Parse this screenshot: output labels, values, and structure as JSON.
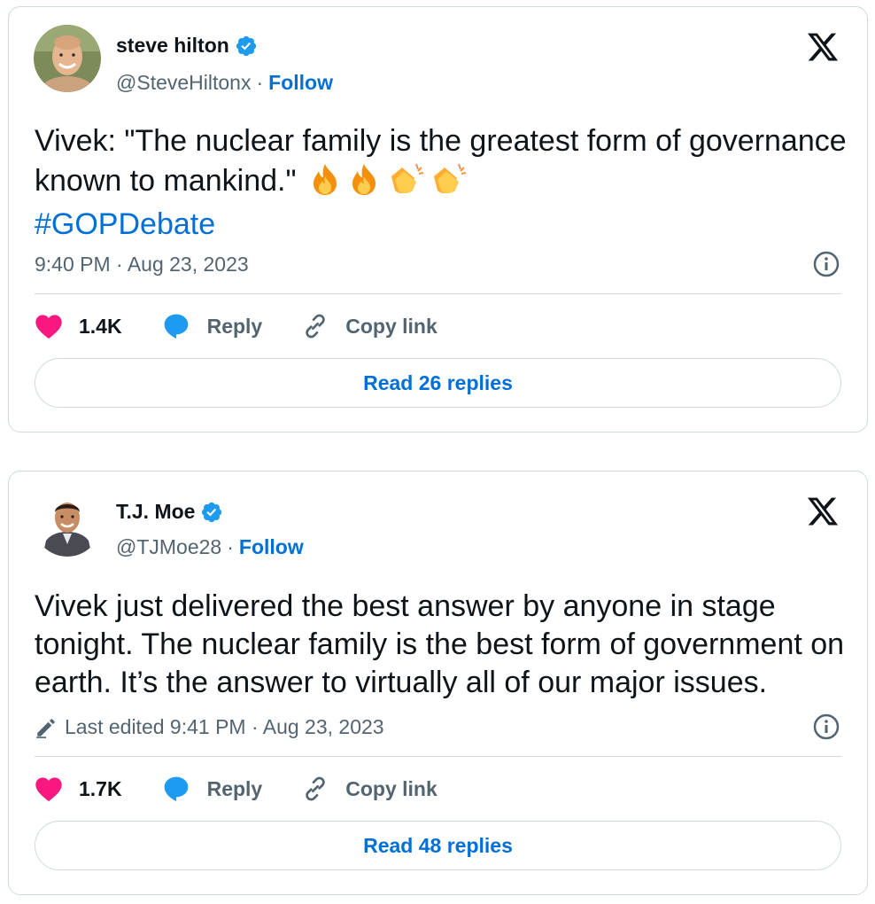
{
  "tweets": [
    {
      "name": "steve hilton",
      "handle": "@SteveHiltonx",
      "separator": "·",
      "follow_label": "Follow",
      "text": "Vivek: \"The nuclear family is the greatest form of governance known to mankind.\"",
      "emojis": [
        "fire",
        "fire",
        "clapping-hands",
        "clapping-hands"
      ],
      "hashtag": "#GOPDebate",
      "timestamp": "9:40 PM · Aug 23, 2023",
      "likes": "1.4K",
      "reply_label": "Reply",
      "copy_link_label": "Copy link",
      "read_replies_label": "Read 26 replies"
    },
    {
      "name": "T.J. Moe",
      "handle": "@TJMoe28",
      "separator": "·",
      "follow_label": "Follow",
      "text": "Vivek just delivered the best answer by anyone in stage tonight. The nuclear family is the best form of government on earth. It’s the answer to virtually all of our major issues.",
      "timestamp": "Last edited 9:41 PM · Aug 23, 2023",
      "likes": "1.7K",
      "reply_label": "Reply",
      "copy_link_label": "Copy link",
      "read_replies_label": "Read 48 replies"
    }
  ],
  "colors": {
    "accent": "#006fd6",
    "like": "#f91880",
    "reply": "#1d9bf0",
    "muted": "#536471",
    "border": "#cfd9de",
    "verified": "#1d9bf0"
  },
  "icons": {
    "verified": "verified-badge-icon",
    "x_logo": "x-logo-icon",
    "info": "info-icon",
    "like": "heart-icon",
    "reply": "speech-bubble-icon",
    "copy_link": "link-icon",
    "edit": "pencil-icon"
  }
}
